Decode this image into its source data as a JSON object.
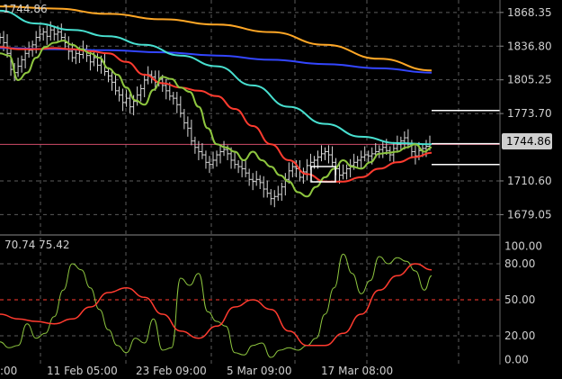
{
  "colors": {
    "background": "#000000",
    "price_bars": "#d8d8d8",
    "green_line": "#8ec63f",
    "red_line": "#ff3b2f",
    "cyan_line": "#48e0d0",
    "orange_line": "#ffa726",
    "blue_line": "#3346ff",
    "grid": "#5c5c5c",
    "level_lines": "#ffffff",
    "pink_line": "#d04b6a",
    "axis_text": "#cfcfcf",
    "price_badge_bg": "#cfcfcf",
    "price_badge_text": "#000000"
  },
  "header": {
    "price_label": "1744.86"
  },
  "chart_data": [
    {
      "type": "line",
      "panel": "price",
      "ylim": [
        1660,
        1880
      ],
      "y_ticks": [
        "1868.35",
        "1836.80",
        "1805.25",
        "1773.70",
        "1744.86",
        "1710.60",
        "1679.05"
      ],
      "x_ticks": [
        ":00",
        "11 Feb 05:00",
        "23 Feb 09:00",
        "5 Mar 09:00",
        "17 Mar 08:00"
      ],
      "current_price": "1744.86",
      "horizontal_levels": [
        1776.5,
        1745.5,
        1726.0
      ],
      "price_ohlc_approx": {
        "x": [
          0,
          4,
          8,
          12,
          16,
          20,
          24,
          28,
          32,
          36,
          40,
          44,
          48,
          52,
          56,
          60,
          64,
          68,
          72,
          76,
          80,
          84,
          88,
          92,
          96,
          100,
          104,
          108,
          112,
          116,
          120,
          124,
          128,
          132,
          136,
          140,
          144,
          148,
          152,
          156,
          160,
          164,
          168,
          172,
          176,
          180,
          184,
          188,
          192,
          196,
          200,
          204,
          208,
          212,
          216,
          220,
          224,
          228,
          232,
          236,
          240,
          244,
          248,
          252,
          256,
          260,
          264,
          268,
          272,
          276,
          280,
          284,
          288,
          292,
          296,
          300,
          304,
          308,
          312,
          316,
          320,
          324,
          328,
          332,
          336,
          340,
          344,
          348,
          352,
          356,
          360,
          364,
          368,
          372,
          376,
          380,
          384,
          388,
          392,
          396,
          400,
          404,
          408,
          412,
          416,
          420,
          424,
          428,
          432,
          436,
          440,
          444,
          448,
          452,
          456,
          460,
          464,
          468,
          472,
          476
        ],
        "close": [
          1845,
          1840,
          1830,
          1815,
          1812,
          1818,
          1824,
          1830,
          1833,
          1838,
          1845,
          1848,
          1850,
          1846,
          1852,
          1848,
          1850,
          1845,
          1840,
          1832,
          1826,
          1830,
          1829,
          1834,
          1828,
          1822,
          1826,
          1819,
          1822,
          1813,
          1809,
          1803,
          1795,
          1791,
          1784,
          1788,
          1780,
          1785,
          1791,
          1797,
          1805,
          1810,
          1808,
          1803,
          1806,
          1800,
          1795,
          1790,
          1788,
          1782,
          1774,
          1765,
          1760,
          1748,
          1742,
          1738,
          1735,
          1728,
          1726,
          1730,
          1735,
          1738,
          1740,
          1736,
          1730,
          1726,
          1724,
          1722,
          1718,
          1712,
          1710,
          1712,
          1709,
          1703,
          1699,
          1694,
          1696,
          1698,
          1705,
          1712,
          1720,
          1724,
          1722,
          1714,
          1719,
          1725,
          1728,
          1730,
          1733,
          1736,
          1738,
          1735,
          1728,
          1722,
          1716,
          1718,
          1722,
          1725,
          1728,
          1730,
          1733,
          1735,
          1734,
          1736,
          1738,
          1740,
          1742,
          1739,
          1735,
          1741,
          1745,
          1748,
          1751,
          1745,
          1738,
          1734,
          1739,
          1741,
          1743,
          1745
        ]
      },
      "series": [
        {
          "name": "",
          "color_key": "green_line",
          "x": [
            0,
            10,
            20,
            30,
            40,
            50,
            60,
            70,
            80,
            90,
            100,
            110,
            120,
            130,
            140,
            150,
            160,
            170,
            180,
            190,
            200,
            210,
            220,
            230,
            240,
            250,
            260,
            270,
            280,
            290,
            300,
            310,
            320,
            330,
            340,
            350,
            360,
            370,
            380,
            390,
            400,
            410,
            420,
            430,
            440,
            450,
            460,
            470,
            478
          ],
          "y": [
            1830,
            1828,
            1805,
            1812,
            1826,
            1836,
            1840,
            1842,
            1838,
            1834,
            1830,
            1826,
            1816,
            1810,
            1798,
            1786,
            1782,
            1796,
            1808,
            1806,
            1798,
            1794,
            1780,
            1760,
            1745,
            1742,
            1738,
            1730,
            1738,
            1730,
            1724,
            1716,
            1710,
            1700,
            1696,
            1705,
            1714,
            1722,
            1730,
            1724,
            1722,
            1728,
            1736,
            1737,
            1738,
            1742,
            1745,
            1738,
            1742
          ]
        },
        {
          "name": "",
          "color_key": "red_line",
          "x": [
            0,
            20,
            40,
            60,
            80,
            100,
            120,
            140,
            160,
            180,
            200,
            220,
            240,
            260,
            280,
            300,
            320,
            340,
            360,
            380,
            400,
            420,
            440,
            460,
            478
          ],
          "y": [
            1836,
            1834,
            1834,
            1835,
            1834,
            1832,
            1830,
            1822,
            1810,
            1802,
            1798,
            1795,
            1790,
            1778,
            1762,
            1745,
            1730,
            1717,
            1710,
            1710,
            1714,
            1722,
            1728,
            1733,
            1737
          ]
        },
        {
          "name": "",
          "color_key": "cyan_line",
          "x": [
            0,
            40,
            80,
            120,
            160,
            200,
            240,
            280,
            320,
            360,
            400,
            440,
            478
          ],
          "y": [
            1870,
            1858,
            1852,
            1846,
            1838,
            1828,
            1818,
            1800,
            1780,
            1764,
            1752,
            1746,
            1745
          ]
        },
        {
          "name": "",
          "color_key": "orange_line",
          "x": [
            0,
            60,
            120,
            180,
            240,
            300,
            360,
            420,
            478
          ],
          "y": [
            1874,
            1872,
            1867,
            1862,
            1857,
            1850,
            1838,
            1825,
            1814
          ]
        },
        {
          "name": "",
          "color_key": "blue_line",
          "x": [
            0,
            60,
            120,
            180,
            240,
            300,
            360,
            420,
            478
          ],
          "y": [
            1835,
            1834,
            1833,
            1831,
            1828,
            1824,
            1820,
            1816,
            1812
          ]
        }
      ]
    },
    {
      "type": "line",
      "panel": "oscillator",
      "legend_text": "70.74 75.42",
      "ylim": [
        -4,
        104
      ],
      "y_ticks": [
        "100.00",
        "80.00",
        "50.00",
        "20.00",
        "0.00"
      ],
      "levels": [
        80,
        50,
        20
      ],
      "series": [
        {
          "name": "",
          "color_key": "green_line",
          "x": [
            0,
            10,
            20,
            30,
            40,
            50,
            60,
            70,
            80,
            90,
            100,
            110,
            120,
            130,
            140,
            150,
            160,
            170,
            180,
            190,
            200,
            210,
            220,
            230,
            240,
            250,
            260,
            270,
            280,
            290,
            300,
            310,
            320,
            330,
            340,
            350,
            360,
            370,
            380,
            390,
            400,
            410,
            420,
            430,
            440,
            450,
            460,
            470,
            478
          ],
          "y": [
            15,
            10,
            12,
            30,
            18,
            22,
            36,
            58,
            80,
            75,
            60,
            42,
            25,
            12,
            6,
            18,
            14,
            34,
            8,
            10,
            68,
            62,
            72,
            40,
            32,
            28,
            6,
            4,
            12,
            14,
            2,
            8,
            10,
            8,
            12,
            18,
            38,
            60,
            88,
            72,
            55,
            66,
            86,
            80,
            85,
            82,
            74,
            58,
            70
          ]
        },
        {
          "name": "",
          "color_key": "red_line",
          "x": [
            0,
            20,
            40,
            60,
            80,
            100,
            120,
            140,
            160,
            180,
            200,
            220,
            240,
            260,
            280,
            300,
            320,
            340,
            360,
            380,
            400,
            420,
            440,
            460,
            478
          ],
          "y": [
            38,
            34,
            32,
            30,
            34,
            44,
            56,
            60,
            52,
            38,
            24,
            18,
            28,
            44,
            50,
            42,
            24,
            12,
            12,
            22,
            38,
            58,
            70,
            80,
            75
          ]
        }
      ]
    }
  ]
}
